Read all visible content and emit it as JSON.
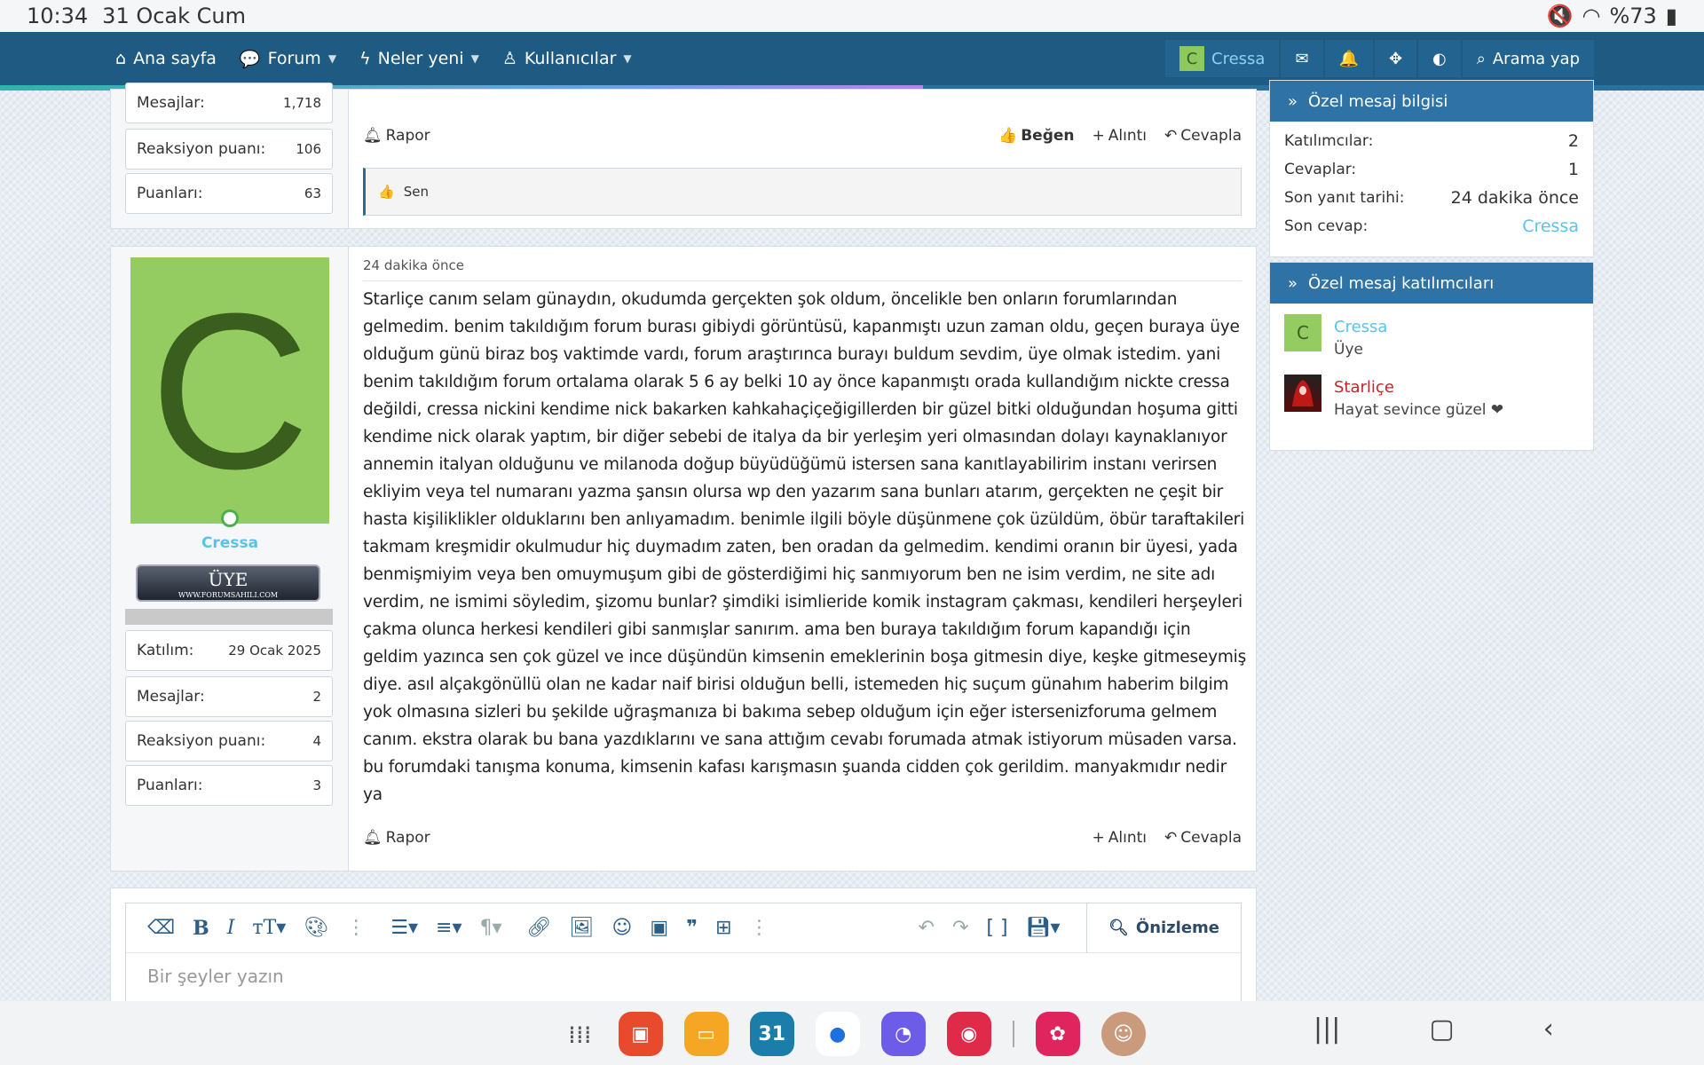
{
  "status_bar": {
    "time": "10:34",
    "date": "31 Ocak Cum",
    "battery": "%73"
  },
  "nav": {
    "home": "Ana sayfa",
    "forum": "Forum",
    "whats_new": "Neler yeni",
    "members": "Kullanıcılar",
    "user": "Cressa",
    "user_initial": "C",
    "search": "Arama yap"
  },
  "prev_post": {
    "stats": [
      {
        "label": "Mesajlar:",
        "value": "1,718"
      },
      {
        "label": "Reaksiyon puanı:",
        "value": "106"
      },
      {
        "label": "Puanları:",
        "value": "63"
      }
    ],
    "report": "Rapor",
    "like": "Beğen",
    "quote": "Alıntı",
    "reply": "Cevapla",
    "liked_by": "Sen"
  },
  "post": {
    "avatar_letter": "C",
    "username": "Cressa",
    "rank_title": "ÜYE",
    "rank_sub": "WWW.FORUMSAHILI.COM",
    "stats": [
      {
        "label": "Katılım:",
        "value": "29 Ocak 2025"
      },
      {
        "label": "Mesajlar:",
        "value": "2"
      },
      {
        "label": "Reaksiyon puanı:",
        "value": "4"
      },
      {
        "label": "Puanları:",
        "value": "3"
      }
    ],
    "date": "24 dakika önce",
    "body": "Starliçe canım selam günaydın, okudumda gerçekten şok oldum, öncelikle ben onların forumlarından gelmedim. benim takıldığım forum burası gibiydi görüntüsü, kapanmıştı uzun zaman oldu, geçen buraya üye olduğum günü biraz boş vaktimde vardı, forum araştırınca burayı buldum sevdim, üye olmak istedim. yani benim takıldığım forum ortalama olarak 5 6 ay belki 10 ay önce kapanmıştı orada kullandığım nickte cressa değildi, cressa nickini kendime nick bakarken kahkahaçiçeğigillerden bir güzel bitki olduğundan hoşuma gitti kendime nick olarak yaptım, bir diğer sebebi de italya da bir yerleşim yeri olmasından dolayı kaynaklanıyor annemin italyan olduğunu ve milanoda doğup büyüdüğümü istersen sana kanıtlayabilirim instanı verirsen ekliyim veya tel numaranı yazma şansın olursa wp den yazarım sana bunları atarım, gerçekten ne çeşit bir hasta kişiliklikler olduklarını ben anlıyamadım. benimle ilgili böyle düşünmene çok üzüldüm, öbür taraftakileri takmam kreşmidir okulmudur hiç duymadım zaten, ben oradan da gelmedim. kendimi oranın bir üyesi, yada benmişmiyim veya ben omuymuşum gibi de gösterdiğimi hiç sanmıyorum ben ne isim verdim, ne site adı verdim, ne ismimi söyledim, şizomu bunlar? şimdiki isimlieride komik instagram çakması, kendileri herşeyleri çakma olunca herkesi kendileri gibi sanmışlar sanırım. ama ben buraya takıldığım forum kapandığı için geldim yazınca sen çok güzel ve ince düşündün kimsenin emeklerinin boşa gitmesin diye, keşke gitmeseymiş diye. asıl alçakgönüllü olan ne kadar naif birisi olduğun belli, istemeden hiç suçum günahım haberim bilgim yok olmasına sizleri bu şekilde uğraşmanıza bi bakıma sebep olduğum için eğer istersenizforuma gelmem canım. ekstra olarak bu bana yazdıklarını ve sana attığım cevabı forumada atmak istiyorum müsaden varsa. bu forumdaki tanışma konuma, kimsenin kafası karışmasın şuanda cidden çok gerildim. manyakmıdır nedir ya",
    "report": "Rapor",
    "quote": "Alıntı",
    "reply": "Cevapla"
  },
  "sidebar": {
    "info": {
      "title": "Özel mesaj bilgisi",
      "rows": [
        {
          "label": "Katılımcılar:",
          "value": "2"
        },
        {
          "label": "Cevaplar:",
          "value": "1"
        },
        {
          "label": "Son yanıt tarihi:",
          "value": "24 dakika önce"
        },
        {
          "label": "Son cevap:",
          "value": "Cressa"
        }
      ]
    },
    "participants": {
      "title": "Özel mesaj katılımcıları",
      "members": [
        {
          "name": "Cressa",
          "title": "Üye",
          "initial": "C"
        },
        {
          "name": "Starliçe",
          "title": "Hayat sevince güzel ❤"
        }
      ]
    }
  },
  "editor": {
    "placeholder": "Bir şeyler yazın",
    "preview": "Önizleme"
  },
  "dock": {
    "calendar_day": "31"
  },
  "colors": {
    "nav_bg": "#1f5a82",
    "accent": "#2f73a6",
    "link": "#5cc2e8",
    "avatar_green": "#95cc62"
  }
}
